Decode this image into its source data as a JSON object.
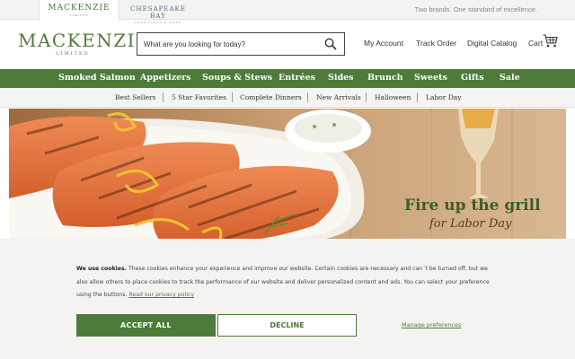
{
  "brands": {
    "mackenzie": {
      "name": "MACKENZIE",
      "sub": "LIMITED"
    },
    "chesapeake": {
      "name": "CHESAPEAKE BAY",
      "sub": "CRAB CAKES & MORE"
    },
    "tagline": "Two brands. One standard of excellence."
  },
  "header": {
    "logo": {
      "main": "MACKENZIE",
      "sub": "LIMITED"
    },
    "search_placeholder": "What are you looking for today?",
    "links": {
      "account": "My Account",
      "track": "Track Order",
      "catalog": "Digital Catalog",
      "cart": "Cart"
    }
  },
  "main_nav": [
    "Smoked Salmon",
    "Appetizers",
    "Soups & Stews",
    "Entrées",
    "Sides",
    "Brunch",
    "Sweets",
    "Gifts",
    "Sale"
  ],
  "sub_nav": [
    "Best Sellers",
    "5 Star Favorites",
    "Complete Dinners",
    "New Arrivals",
    "Halloween",
    "Labor Day"
  ],
  "hero": {
    "title": "Fire up the grill",
    "subtitle": "for Labor Day"
  },
  "cookie": {
    "bold": "We use cookies.",
    "text": " These cookies enhance your experience and improve our website. Certain cookies are necessary and can´t be turned off, but we also allow others to place cookies to track the performance of our website and deliver personalized content and ads. You can select your preference using the buttons. ",
    "link": "Read our privacy policy",
    "accept": "ACCEPT ALL",
    "decline": "DECLINE",
    "manage": "Manage preferences"
  },
  "colors": {
    "brand_green": "#4d7b3a",
    "nav_text": "#ffffff"
  }
}
